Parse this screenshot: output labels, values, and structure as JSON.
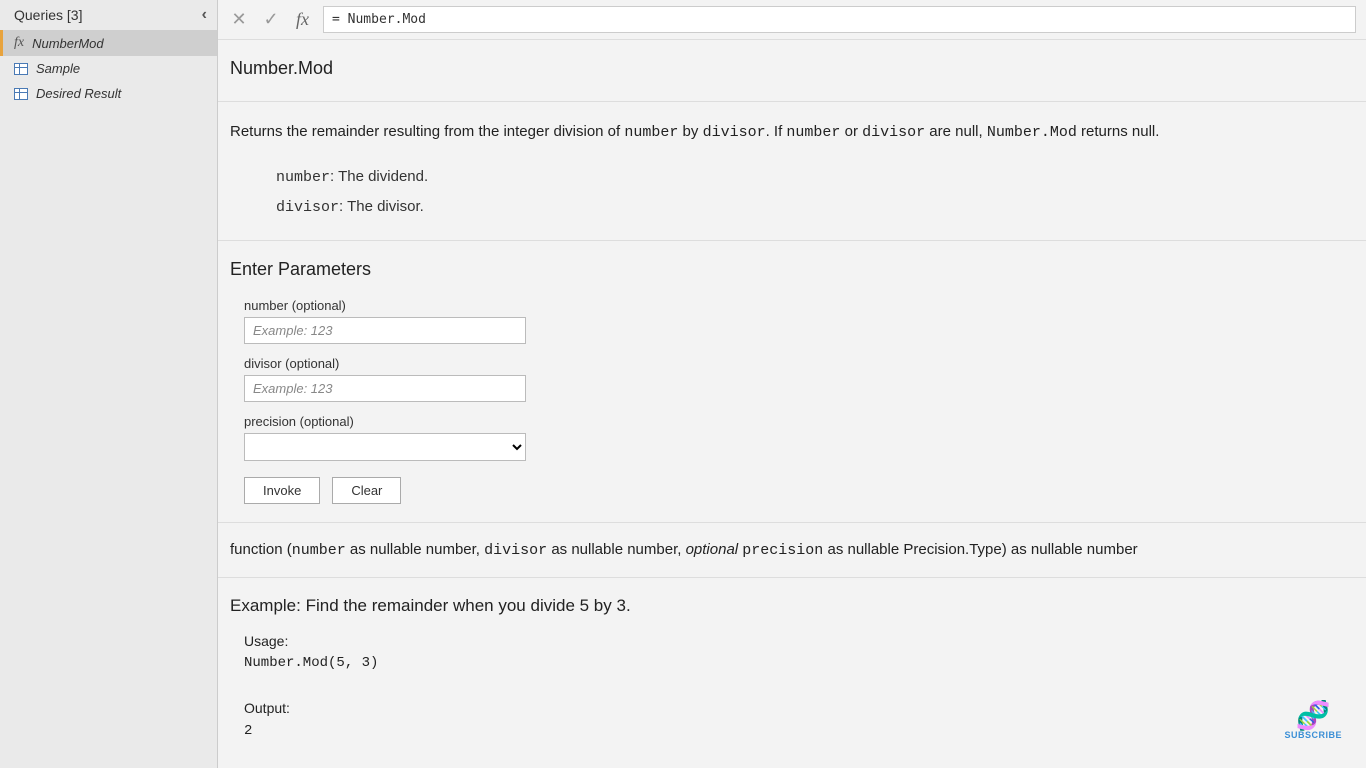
{
  "sidebar": {
    "title": "Queries [3]",
    "items": [
      {
        "label": "NumberMod",
        "type": "fx",
        "selected": true
      },
      {
        "label": "Sample",
        "type": "table",
        "selected": false
      },
      {
        "label": "Desired Result",
        "type": "table",
        "selected": false
      }
    ]
  },
  "formula_bar": {
    "value": "= Number.Mod"
  },
  "doc": {
    "title": "Number.Mod",
    "description_parts": {
      "p1": "Returns the remainder resulting from the integer division of ",
      "c1": "number",
      "p2": " by ",
      "c2": "divisor",
      "p3": ". If ",
      "c3": "number",
      "p4": " or ",
      "c4": "divisor",
      "p5": " are null, ",
      "c5": "Number.Mod",
      "p6": " returns null."
    },
    "params_desc": [
      {
        "code": "number",
        "text": ": The dividend."
      },
      {
        "code": "divisor",
        "text": ": The divisor."
      }
    ]
  },
  "enter_params": {
    "title": "Enter Parameters",
    "fields": [
      {
        "label": "number (optional)",
        "placeholder": "Example: 123",
        "type": "text"
      },
      {
        "label": "divisor (optional)",
        "placeholder": "Example: 123",
        "type": "text"
      },
      {
        "label": "precision (optional)",
        "placeholder": "",
        "type": "select"
      }
    ],
    "invoke_label": "Invoke",
    "clear_label": "Clear"
  },
  "signature": {
    "p1": "function (",
    "c1": "number",
    "p2": " as nullable number, ",
    "c2": "divisor",
    "p3": " as nullable number, ",
    "i1": "optional",
    "p4": " ",
    "c3": "precision",
    "p5": " as nullable Precision.Type) as nullable number"
  },
  "example": {
    "title": "Example: Find the remainder when you divide 5 by 3.",
    "usage_label": "Usage:",
    "usage_code": "Number.Mod(5, 3)",
    "output_label": "Output:",
    "output_value": "2"
  },
  "subscribe_label": "SUBSCRIBE"
}
